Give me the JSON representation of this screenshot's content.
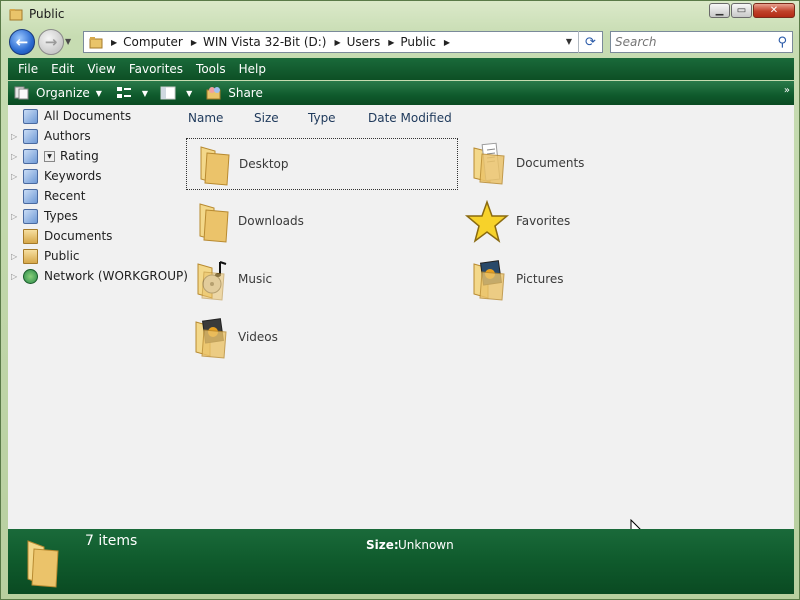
{
  "window": {
    "title": "Public"
  },
  "navigation": {
    "breadcrumbs": [
      "Computer",
      "WIN Vista 32-Bit (D:)",
      "Users",
      "Public"
    ],
    "search_placeholder": "Search"
  },
  "menu": {
    "items": [
      "File",
      "Edit",
      "View",
      "Favorites",
      "Tools",
      "Help"
    ]
  },
  "toolbar": {
    "organize_label": "Organize",
    "share_label": "Share",
    "overflow_glyph": "»"
  },
  "nav_pane": {
    "items": [
      {
        "label": "All Documents",
        "icon": "virtual-folder-icon",
        "expandable": false
      },
      {
        "label": "Authors",
        "icon": "virtual-folder-icon",
        "expandable": true
      },
      {
        "label": "Rating",
        "icon": "virtual-folder-icon",
        "expandable": true
      },
      {
        "label": "Keywords",
        "icon": "virtual-folder-icon",
        "expandable": true
      },
      {
        "label": "Recent",
        "icon": "virtual-folder-icon",
        "expandable": false
      },
      {
        "label": "Types",
        "icon": "virtual-folder-icon",
        "expandable": true
      },
      {
        "label": "Documents",
        "icon": "folder-icon",
        "expandable": false
      },
      {
        "label": "Public",
        "icon": "folder-icon",
        "expandable": true
      },
      {
        "label": "Network (WORKGROUP)",
        "icon": "network-icon",
        "expandable": true
      }
    ]
  },
  "columns": [
    "Name",
    "Size",
    "Type",
    "Date Modified"
  ],
  "files": [
    {
      "label": "Desktop",
      "icon": "folder-icon",
      "selected": true
    },
    {
      "label": "Documents",
      "icon": "documents-folder-icon",
      "selected": false
    },
    {
      "label": "Downloads",
      "icon": "folder-icon",
      "selected": false
    },
    {
      "label": "Favorites",
      "icon": "star-icon",
      "selected": false
    },
    {
      "label": "Music",
      "icon": "music-folder-icon",
      "selected": false
    },
    {
      "label": "Pictures",
      "icon": "pictures-folder-icon",
      "selected": false
    },
    {
      "label": "Videos",
      "icon": "videos-folder-icon",
      "selected": false
    }
  ],
  "details": {
    "count": "7 items",
    "size_label": "Size:",
    "size_value": "Unknown"
  },
  "colors": {
    "accent_green": "#0f5a2c",
    "content_bg": "#f1f1f1",
    "column_header_text": "#1e395b"
  }
}
